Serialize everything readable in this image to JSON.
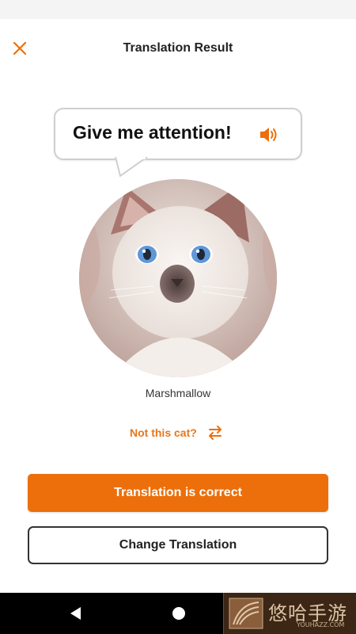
{
  "header": {
    "title": "Translation Result",
    "close_icon": "close-icon"
  },
  "translation": {
    "text": "Give me attention!",
    "speaker_icon": "speaker-icon"
  },
  "cat": {
    "name": "Marshmallow",
    "photo_description_icon": "cat-photo"
  },
  "switch_cat": {
    "label": "Not this cat?",
    "icon": "swap-arrows-icon"
  },
  "actions": {
    "confirm_label": "Translation is correct",
    "change_label": "Change Translation"
  },
  "nav": {
    "back_icon": "back-triangle-icon",
    "home_icon": "home-circle-icon"
  },
  "watermark": {
    "text": "悠哈手游",
    "url": "YOUHAZZ.COM"
  },
  "colors": {
    "accent": "#ec6f0b",
    "accent_text": "#e8761a",
    "nav_background": "#000000"
  }
}
